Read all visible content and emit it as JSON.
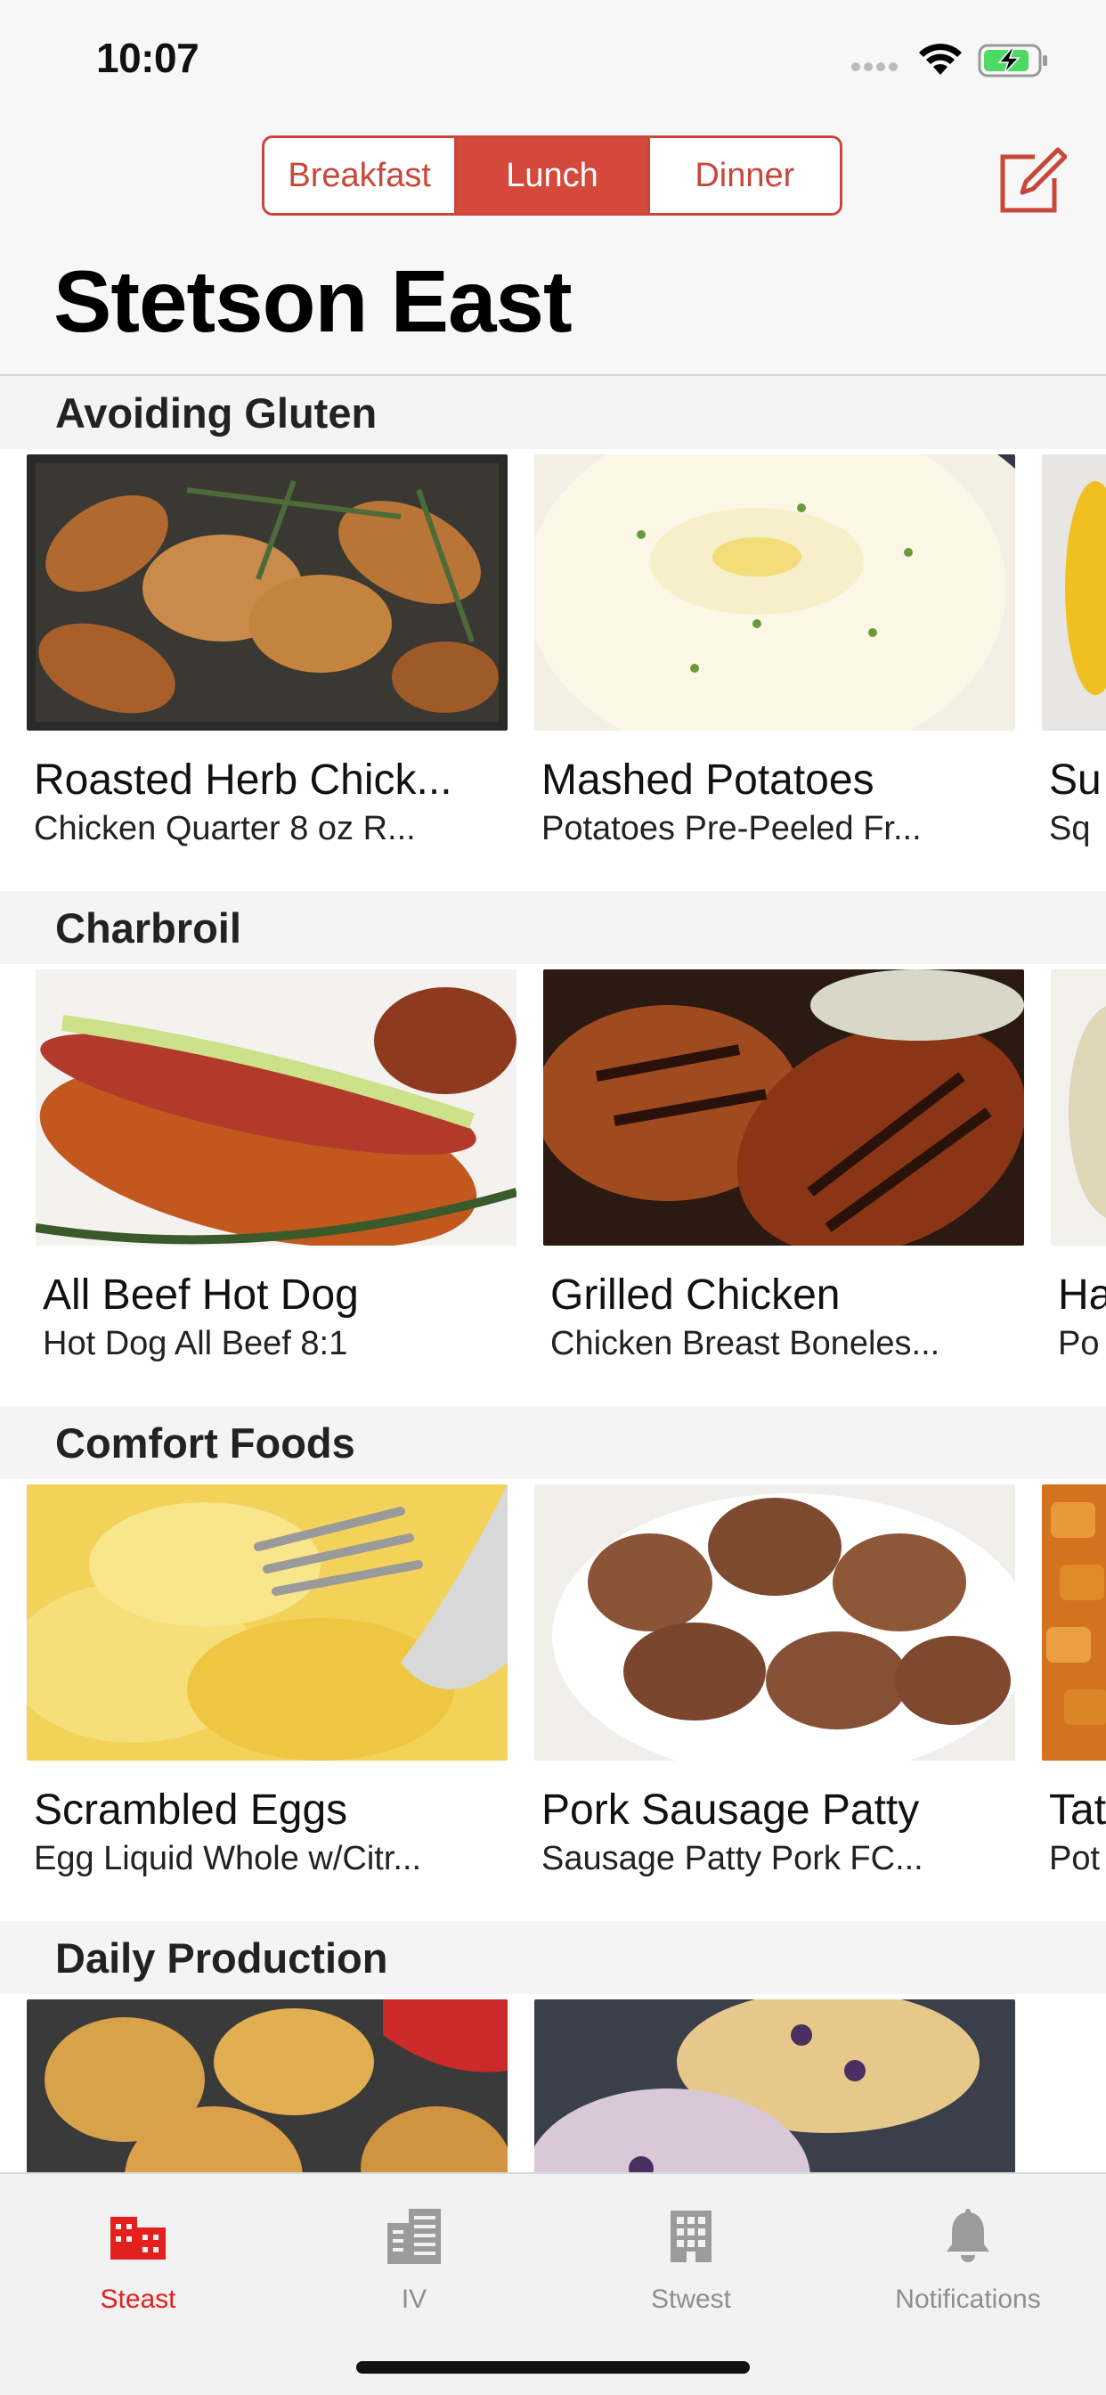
{
  "status_bar": {
    "time": "10:07"
  },
  "meal_tabs": [
    {
      "label": "Breakfast",
      "selected": false
    },
    {
      "label": "Lunch",
      "selected": true
    },
    {
      "label": "Dinner",
      "selected": false
    }
  ],
  "page_title": "Stetson East",
  "colors": {
    "accent": "#d4493b",
    "tab_active": "#e4201f",
    "tab_inactive": "#8e8e93"
  },
  "sections": [
    {
      "title": "Avoiding Gluten",
      "items": [
        {
          "name": "Roasted Herb Chick...",
          "desc": "Chicken Quarter 8 oz R..."
        },
        {
          "name": "Mashed Potatoes",
          "desc": "Potatoes Pre-Peeled Fr..."
        },
        {
          "name": "Su",
          "desc": "Sq"
        }
      ]
    },
    {
      "title": "Charbroil",
      "items": [
        {
          "name": "All Beef Hot Dog",
          "desc": "Hot Dog All Beef 8:1"
        },
        {
          "name": "Grilled Chicken",
          "desc": "Chicken Breast Boneles..."
        },
        {
          "name": "Ha",
          "desc": "Po"
        }
      ]
    },
    {
      "title": "Comfort Foods",
      "items": [
        {
          "name": "Scrambled Eggs",
          "desc": "Egg Liquid Whole w/Citr..."
        },
        {
          "name": "Pork Sausage Patty",
          "desc": "Sausage Patty Pork FC..."
        },
        {
          "name": "Tat",
          "desc": "Pot"
        }
      ]
    },
    {
      "title": "Daily Production",
      "items": []
    }
  ],
  "tabbar": [
    {
      "label": "Steast",
      "icon": "building-icon",
      "active": true
    },
    {
      "label": "IV",
      "icon": "office-tower-icon",
      "active": false
    },
    {
      "label": "Stwest",
      "icon": "apartment-icon",
      "active": false
    },
    {
      "label": "Notifications",
      "icon": "bell-icon",
      "active": false
    }
  ]
}
